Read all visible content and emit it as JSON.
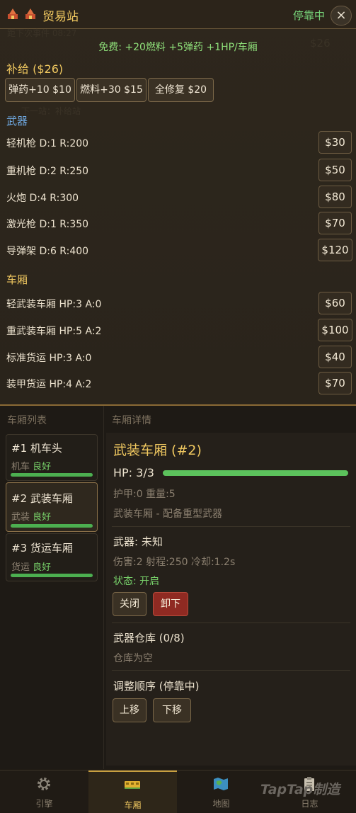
{
  "header": {
    "title": "贸易站",
    "status": "停靠中",
    "close_icon": "×"
  },
  "background_hud": {
    "distance_text": "距下次事件 08:27",
    "station_label": "下一站：补给站",
    "price_ghost": "$26"
  },
  "free_line": "免费: +20燃料 +5弹药 +1HP/车厢",
  "supply": {
    "title": "补给 ($26)",
    "buttons": [
      {
        "label": "弹药+10 $10"
      },
      {
        "label": "燃料+30 $15"
      },
      {
        "label": "全修复 $20"
      }
    ]
  },
  "weapons": {
    "title": "武器",
    "items": [
      {
        "label": "轻机枪 D:1 R:200",
        "price": "$30"
      },
      {
        "label": "重机枪 D:2 R:250",
        "price": "$50"
      },
      {
        "label": "火炮 D:4 R:300",
        "price": "$80"
      },
      {
        "label": "激光枪 D:1 R:350",
        "price": "$70"
      },
      {
        "label": "导弹架 D:6 R:400",
        "price": "$120"
      }
    ]
  },
  "cars_shop": {
    "title": "车厢",
    "items": [
      {
        "label": "轻武装车厢 HP:3 A:0",
        "price": "$60"
      },
      {
        "label": "重武装车厢 HP:5 A:2",
        "price": "$100"
      },
      {
        "label": "标准货运 HP:3 A:0",
        "price": "$40"
      },
      {
        "label": "装甲货运 HP:4 A:2",
        "price": "$70"
      }
    ]
  },
  "car_list": {
    "header": "车厢列表",
    "items": [
      {
        "name": "#1 机车头",
        "type": "机车",
        "status": "良好",
        "hp_fraction": 1.0
      },
      {
        "name": "#2 武装车厢",
        "type": "武装",
        "status": "良好",
        "hp_fraction": 1.0,
        "selected": true
      },
      {
        "name": "#3 货运车厢",
        "type": "货运",
        "status": "良好",
        "hp_fraction": 1.0
      }
    ]
  },
  "details": {
    "header": "车厢详情",
    "title": "武装车厢 (#2)",
    "hp": "HP: 3/3",
    "hp_fraction": 1.0,
    "stats": "护甲:0  重量:5",
    "description": "武装车厢 - 配备重型武器",
    "weapon": "武器: 未知",
    "weapon_stats": "伤害:2  射程:250  冷却:1.2s",
    "weapon_status": "状态: 开启",
    "btn_off": "关闭",
    "btn_unload": "卸下",
    "storage_title": "武器仓库 (0/8)",
    "storage_empty": "仓库为空",
    "order_title": "调整顺序 (停靠中)",
    "btn_up": "上移",
    "btn_down": "下移"
  },
  "tabs": [
    {
      "label": "引擎",
      "icon": "gear-icon"
    },
    {
      "label": "车厢",
      "icon": "train-car-icon",
      "active": true
    },
    {
      "label": "地图",
      "icon": "map-icon"
    },
    {
      "label": "日志",
      "icon": "clipboard-icon"
    }
  ],
  "watermark": "TapTap制造",
  "colors": {
    "accent_gold": "#f0c860",
    "status_green": "#78d26a",
    "section_blue": "#6fa8e0",
    "danger_red": "#8f2a22"
  }
}
